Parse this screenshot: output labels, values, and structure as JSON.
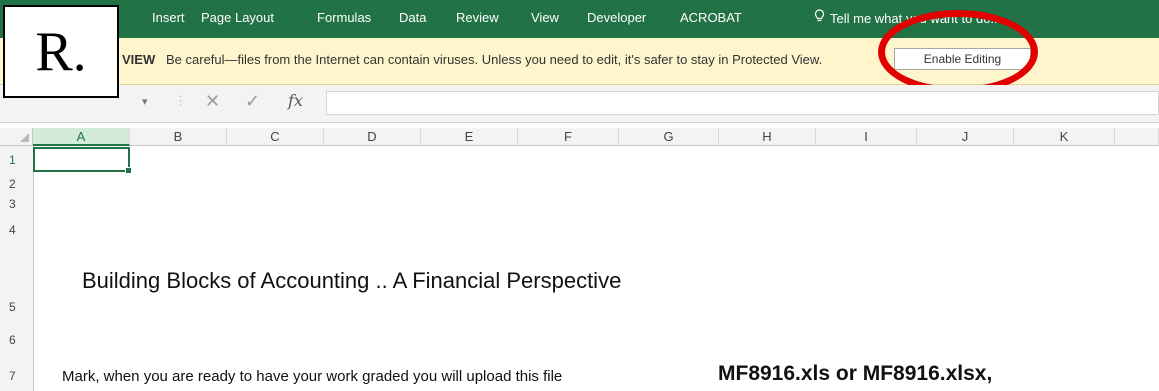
{
  "ribbon": {
    "tabs": [
      "Insert",
      "Page Layout",
      "Formulas",
      "Data",
      "Review",
      "View",
      "Developer",
      "ACROBAT"
    ],
    "tell_me": "Tell me what you want to do..."
  },
  "message_bar": {
    "title": "VIEW",
    "text": "Be careful—files from the Internet can contain viruses. Unless you need to edit, it's safer to stay in Protected View.",
    "button_label": "Enable Editing"
  },
  "formula_bar": {
    "cancel_symbol": "✕",
    "enter_symbol": "✓",
    "fx_label": "fx",
    "value": ""
  },
  "overlay_label": "R.",
  "columns": [
    "A",
    "B",
    "C",
    "D",
    "E",
    "F",
    "G",
    "H",
    "I",
    "J",
    "K"
  ],
  "rows": [
    "1",
    "2",
    "3",
    "4",
    "5",
    "6",
    "7"
  ],
  "cells": {
    "a5_heading": "Building Blocks of Accounting .. A Financial Perspective",
    "a7_text": "Mark, when you are ready to have your work graded you will upload this file",
    "h7_text": "MF8916.xls or MF8916.xlsx,"
  },
  "colors": {
    "ribbon": "#217346",
    "message_bar": "#fff5cc",
    "highlight_circle": "#e00000"
  }
}
